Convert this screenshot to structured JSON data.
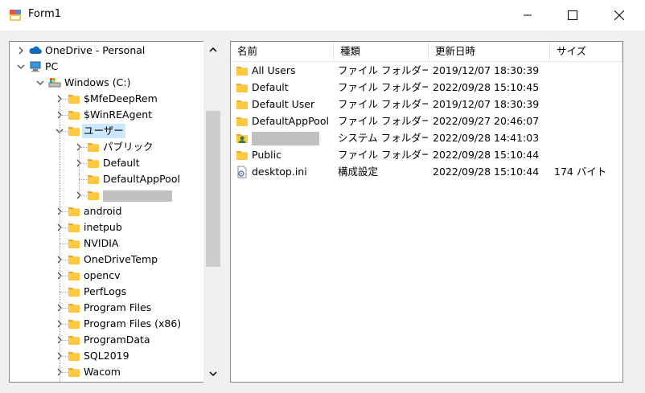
{
  "window": {
    "title": "Form1",
    "minimize_glyph": "—",
    "maximize_glyph": "☐",
    "close_glyph": "✕"
  },
  "tree": {
    "items": [
      {
        "label": "OneDrive - Personal",
        "icon": "onedrive-cloud-icon",
        "level": 0,
        "expander": "collapsed"
      },
      {
        "label": "PC",
        "icon": "computer-icon",
        "level": 0,
        "expander": "expanded"
      },
      {
        "label": "Windows (C:)",
        "icon": "drive-icon",
        "level": 1,
        "expander": "expanded"
      },
      {
        "label": "$MfeDeepRem",
        "icon": "folder-icon",
        "level": 2,
        "expander": "collapsed"
      },
      {
        "label": "$WinREAgent",
        "icon": "folder-icon",
        "level": 2,
        "expander": "collapsed"
      },
      {
        "label": "ユーザー",
        "icon": "folder-icon",
        "level": 2,
        "expander": "expanded",
        "selected": true
      },
      {
        "label": "パブリック",
        "icon": "folder-icon",
        "level": 3,
        "expander": "collapsed"
      },
      {
        "label": "Default",
        "icon": "folder-icon",
        "level": 3,
        "expander": "collapsed"
      },
      {
        "label": "DefaultAppPool",
        "icon": "folder-icon",
        "level": 3,
        "expander": "none"
      },
      {
        "label": "",
        "icon": "folder-icon",
        "level": 3,
        "expander": "collapsed",
        "redacted": true
      },
      {
        "label": "android",
        "icon": "folder-icon",
        "level": 2,
        "expander": "collapsed"
      },
      {
        "label": "inetpub",
        "icon": "folder-icon",
        "level": 2,
        "expander": "collapsed"
      },
      {
        "label": "NVIDIA",
        "icon": "folder-icon",
        "level": 2,
        "expander": "none"
      },
      {
        "label": "OneDriveTemp",
        "icon": "folder-icon",
        "level": 2,
        "expander": "collapsed"
      },
      {
        "label": "opencv",
        "icon": "folder-icon",
        "level": 2,
        "expander": "collapsed"
      },
      {
        "label": "PerfLogs",
        "icon": "folder-icon",
        "level": 2,
        "expander": "none"
      },
      {
        "label": "Program Files",
        "icon": "folder-icon",
        "level": 2,
        "expander": "collapsed"
      },
      {
        "label": "Program Files (x86)",
        "icon": "folder-icon",
        "level": 2,
        "expander": "collapsed"
      },
      {
        "label": "ProgramData",
        "icon": "folder-icon",
        "level": 2,
        "expander": "collapsed"
      },
      {
        "label": "SQL2019",
        "icon": "folder-icon",
        "level": 2,
        "expander": "collapsed"
      },
      {
        "label": "Wacom",
        "icon": "folder-icon",
        "level": 2,
        "expander": "collapsed"
      }
    ]
  },
  "list": {
    "columns": [
      "名前",
      "種類",
      "更新日時",
      "サイズ"
    ],
    "rows": [
      {
        "name": "All Users",
        "type": "ファイル フォルダー",
        "modified": "2019/12/07 18:30:39",
        "size": "",
        "icon": "folder-icon"
      },
      {
        "name": "Default",
        "type": "ファイル フォルダー",
        "modified": "2022/09/28 15:10:45",
        "size": "",
        "icon": "folder-icon"
      },
      {
        "name": "Default User",
        "type": "ファイル フォルダー",
        "modified": "2019/12/07 18:30:39",
        "size": "",
        "icon": "folder-icon"
      },
      {
        "name": "DefaultAppPool",
        "type": "ファイル フォルダー",
        "modified": "2022/09/27 20:46:07",
        "size": "",
        "icon": "folder-icon"
      },
      {
        "name": "",
        "type": "システム フォルダー",
        "modified": "2022/09/28 14:41:03",
        "size": "",
        "icon": "user-folder-icon",
        "redacted": true
      },
      {
        "name": "Public",
        "type": "ファイル フォルダー",
        "modified": "2022/09/28 15:10:44",
        "size": "",
        "icon": "folder-icon"
      },
      {
        "name": "desktop.ini",
        "type": "構成設定",
        "modified": "2022/09/28 15:10:44",
        "size": "174 バイト",
        "icon": "settings-file-icon"
      }
    ]
  },
  "colors": {
    "folder": "#ffc83d",
    "selection": "#cce8ff",
    "border": "#828790",
    "scroll_thumb": "#cdcdcd"
  }
}
